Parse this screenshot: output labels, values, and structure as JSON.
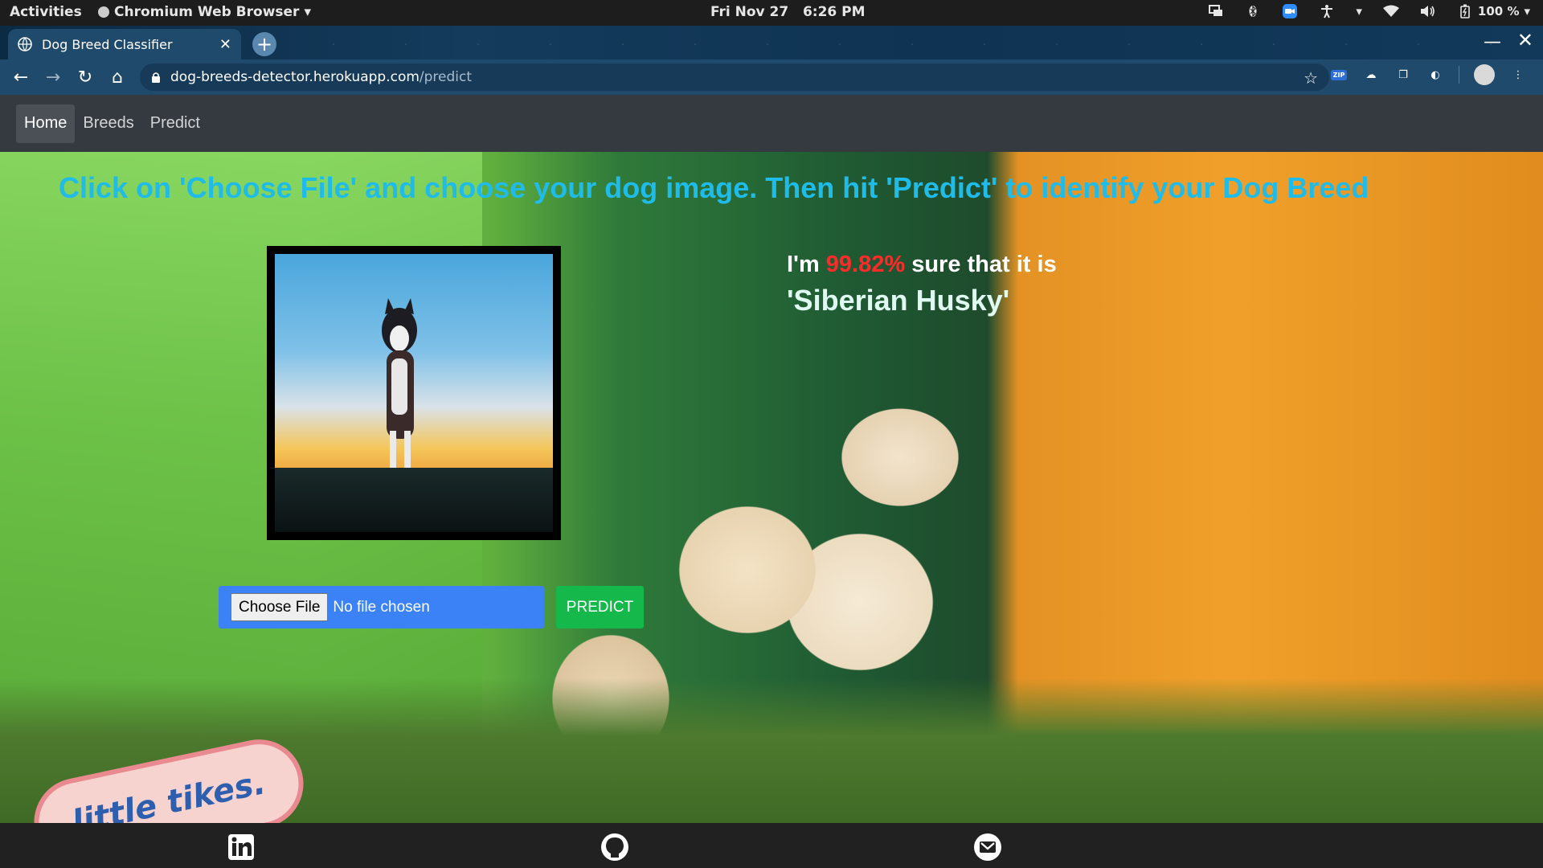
{
  "os": {
    "activities_label": "Activities",
    "app_label": "Chromium Web Browser",
    "clock": "Fri Nov 27   6:26 PM",
    "battery": "100 %"
  },
  "browser": {
    "tab_title": "Dog Breed Classifier",
    "url_host": "dog-breeds-detector.herokuapp.com",
    "url_path": "/predict",
    "ext_zip_label": "ZIP"
  },
  "nav": {
    "items": [
      {
        "label": "Home",
        "active": true
      },
      {
        "label": "Breeds",
        "active": false
      },
      {
        "label": "Predict",
        "active": false
      }
    ]
  },
  "main": {
    "instruction": "Click on 'Choose File' and choose your dog image. Then hit 'Predict' to identify your Dog Breed",
    "result_prefix": "I'm ",
    "confidence": "99.82%",
    "result_suffix": " sure that it is",
    "breed": "'Siberian Husky'",
    "choose_file_label": "Choose File",
    "file_status": "No file chosen",
    "predict_label": "PREDICT",
    "background_logo": "little tikes."
  },
  "colors": {
    "instruction": "#1fbce9",
    "confidence": "#ff2a2a",
    "navbar": "#343a40",
    "predict_button": "#14b84b",
    "upload_box": "#3b82f6"
  },
  "footer": {
    "icons": [
      "linkedin-icon",
      "github-icon",
      "gmail-icon"
    ]
  }
}
